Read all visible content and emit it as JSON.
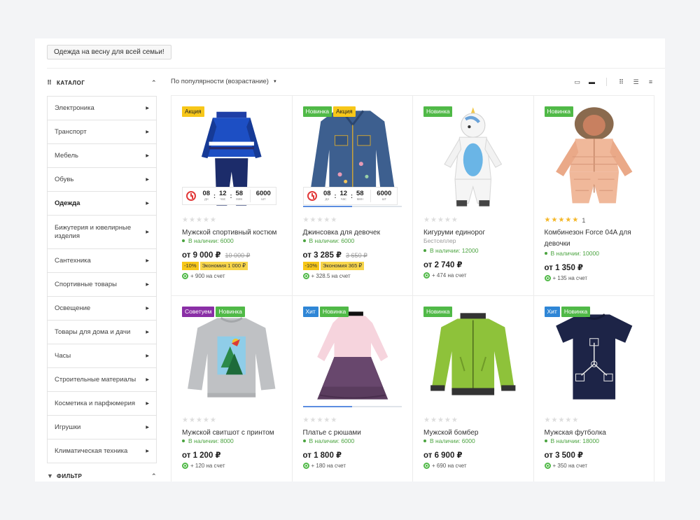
{
  "promo_chip": "Одежда на весну для всей семьи!",
  "sidebar": {
    "catalog_title": "КАТАЛОГ",
    "filter_title": "ФИЛЬТР",
    "items": [
      {
        "label": "Электроника"
      },
      {
        "label": "Транспорт"
      },
      {
        "label": "Мебель"
      },
      {
        "label": "Обувь"
      },
      {
        "label": "Одежда",
        "active": true
      },
      {
        "label": "Бижутерия и ювелирные изделия"
      },
      {
        "label": "Сантехника"
      },
      {
        "label": "Спортивные товары"
      },
      {
        "label": "Освещение"
      },
      {
        "label": "Товары для дома и дачи"
      },
      {
        "label": "Часы"
      },
      {
        "label": "Строительные материалы"
      },
      {
        "label": "Косметика и парфюмерия"
      },
      {
        "label": "Игрушки"
      },
      {
        "label": "Климатическая техника"
      }
    ]
  },
  "toolbar": {
    "sort_label": "По популярности (возрастание)",
    "view_icons": [
      "view-card-icon",
      "view-card-dark-icon",
      "view-grid-icon",
      "view-list-icon",
      "view-table-icon"
    ]
  },
  "colors": {
    "sale": "#f7c719",
    "new": "#50b947",
    "hit": "#2f86d6",
    "advise": "#8a2fa6",
    "stock": "#4aa33f",
    "star": "#f4b728"
  },
  "timer_labels": {
    "days": "дн",
    "hours": "час",
    "minutes": "мин",
    "qty": "шт"
  },
  "products": [
    {
      "id": "p1",
      "badges": [
        {
          "text": "Акция",
          "type": "sale"
        }
      ],
      "art": "tracksuit",
      "timer": {
        "days": "08",
        "hours": "12",
        "minutes": "58",
        "qty": "6000"
      },
      "rating": 0,
      "rating_count": "",
      "name": "Мужской спортивный костюм",
      "subtitle": "",
      "stock": "В наличии: 6000",
      "price": "от 9 000 ₽",
      "old_price": "10 000 ₽",
      "discount": "-10%",
      "saving": "Экономия 1 000 ₽",
      "bonus": "+ 900 на счет"
    },
    {
      "id": "p2",
      "badges": [
        {
          "text": "Новинка",
          "type": "new"
        },
        {
          "text": "Акция",
          "type": "sale"
        }
      ],
      "art": "denim",
      "timer": {
        "days": "08",
        "hours": "12",
        "minutes": "58",
        "qty": "6000"
      },
      "progress": 0.5,
      "rating": 0,
      "rating_count": "",
      "name": "Джинсовка для девочек",
      "subtitle": "",
      "stock": "В наличии: 6000",
      "price": "от 3 285 ₽",
      "old_price": "3 650 ₽",
      "discount": "-10%",
      "saving": "Экономия 365 ₽",
      "bonus": "+ 328.5 на счет"
    },
    {
      "id": "p3",
      "badges": [
        {
          "text": "Новинка",
          "type": "new"
        }
      ],
      "art": "kigurumi",
      "rating": 0,
      "rating_count": "",
      "name": "Кигуруми единорог",
      "subtitle": "Бестселлер",
      "stock": "В наличии: 12000",
      "price": "от 2 740 ₽",
      "old_price": "",
      "discount": "",
      "saving": "",
      "bonus": "+ 474 на счет"
    },
    {
      "id": "p4",
      "badges": [
        {
          "text": "Новинка",
          "type": "new"
        }
      ],
      "art": "snowsuit",
      "rating": 5,
      "rating_count": "1",
      "name": "Комбинезон Force 04A для девочки",
      "subtitle": "",
      "stock": "В наличии: 10000",
      "price": "от 1 350 ₽",
      "old_price": "",
      "discount": "",
      "saving": "",
      "bonus": "+ 135 на счет"
    },
    {
      "id": "p5",
      "badges": [
        {
          "text": "Советуем",
          "type": "advise"
        },
        {
          "text": "Новинка",
          "type": "new"
        }
      ],
      "art": "sweatshirt",
      "rating": 0,
      "rating_count": "",
      "name": "Мужской свитшот с принтом",
      "subtitle": "",
      "stock": "В наличии: 8000",
      "price": "от 1 200 ₽",
      "old_price": "",
      "discount": "",
      "saving": "",
      "bonus": "+ 120 на счет"
    },
    {
      "id": "p6",
      "badges": [
        {
          "text": "Хит",
          "type": "hit"
        },
        {
          "text": "Новинка",
          "type": "new"
        }
      ],
      "art": "dress",
      "progress": 0.5,
      "rating": 0,
      "rating_count": "",
      "name": "Платье с рюшами",
      "subtitle": "",
      "stock": "В наличии: 6000",
      "price": "от 1 800 ₽",
      "old_price": "",
      "discount": "",
      "saving": "",
      "bonus": "+ 180 на счет"
    },
    {
      "id": "p7",
      "badges": [
        {
          "text": "Новинка",
          "type": "new"
        }
      ],
      "art": "bomber",
      "rating": 0,
      "rating_count": "",
      "name": "Мужской бомбер",
      "subtitle": "",
      "stock": "В наличии: 6000",
      "price": "от 6 900 ₽",
      "old_price": "",
      "discount": "",
      "saving": "",
      "bonus": "+ 690 на счет"
    },
    {
      "id": "p8",
      "badges": [
        {
          "text": "Хит",
          "type": "hit"
        },
        {
          "text": "Новинка",
          "type": "new"
        }
      ],
      "art": "tshirt",
      "rating": 0,
      "rating_count": "",
      "name": "Мужская футболка",
      "subtitle": "",
      "stock": "В наличии: 18000",
      "price": "от 3 500 ₽",
      "old_price": "",
      "discount": "",
      "saving": "",
      "bonus": "+ 350 на счет"
    }
  ]
}
